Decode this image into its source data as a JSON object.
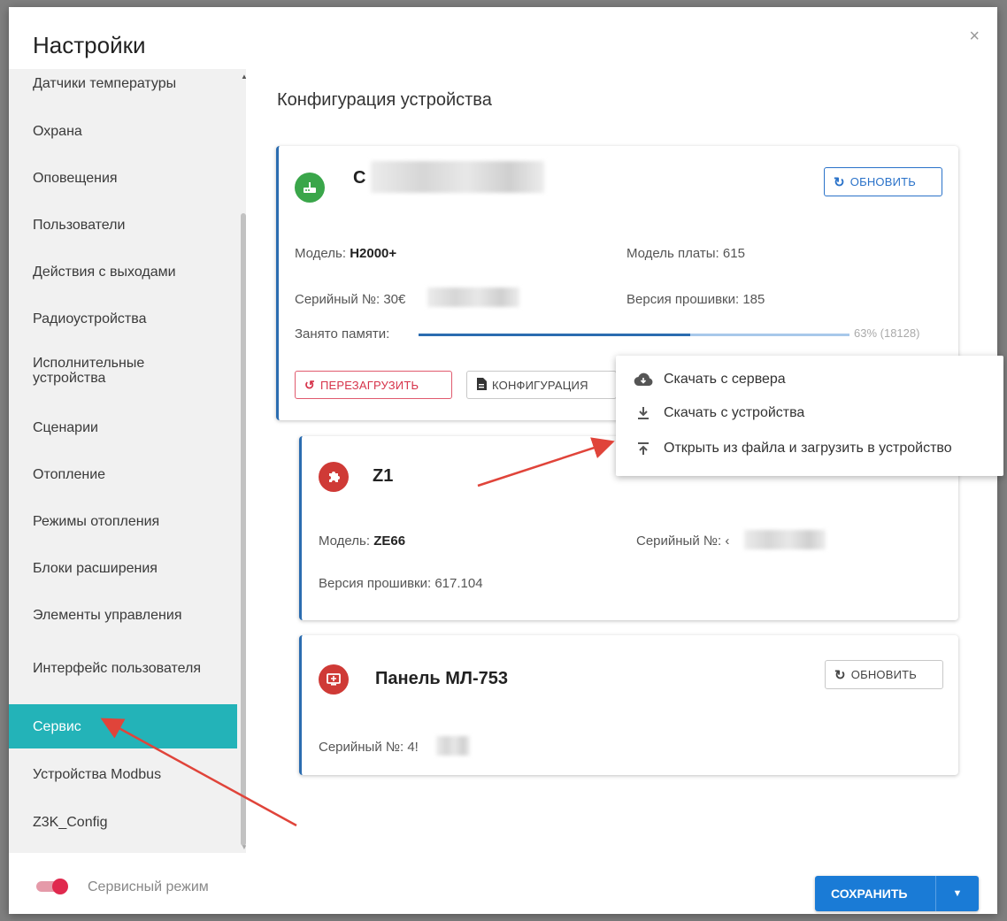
{
  "dialog": {
    "title": "Настройки",
    "close_icon": "×"
  },
  "sidebar": {
    "items": [
      {
        "label": "Датчики температуры",
        "active": false
      },
      {
        "label": "Охрана",
        "active": false
      },
      {
        "label": "Оповещения",
        "active": false
      },
      {
        "label": "Пользователи",
        "active": false
      },
      {
        "label": "Действия с выходами",
        "active": false
      },
      {
        "label": "Радиоустройства",
        "active": false
      },
      {
        "label": "Исполнительные устройства",
        "active": false
      },
      {
        "label": "Сценарии",
        "active": false
      },
      {
        "label": "Отопление",
        "active": false
      },
      {
        "label": "Режимы отопления",
        "active": false
      },
      {
        "label": "Блоки расширения",
        "active": false
      },
      {
        "label": "Элементы управления",
        "active": false
      },
      {
        "label": "Интерфейс пользователя",
        "active": false
      },
      {
        "label": "Сервис",
        "active": true
      },
      {
        "label": "Устройства Modbus",
        "active": false
      },
      {
        "label": "Z3K_Config",
        "active": false
      }
    ]
  },
  "main": {
    "section_title": "Конфигурация устройства",
    "devices": [
      {
        "name_prefix": "С",
        "icon": "router-icon",
        "icon_color": "#3aa64a",
        "refresh_label": "ОБНОВИТЬ",
        "model_label": "Модель:",
        "model_value": "H2000+",
        "board_model": "Модель платы: 615",
        "serial": "Серийный №: 30€",
        "firmware": "Версия прошивки: 185",
        "memory_label": "Занято памяти:",
        "memory_percent": 63,
        "memory_text": "63% (18128)",
        "reboot_label": "ПЕРЕЗАГРУЗИТЬ",
        "config_label": "КОНФИГУРАЦИЯ"
      },
      {
        "name": "Z1",
        "icon": "puzzle-icon",
        "icon_color": "#cf3a36",
        "model_label": "Модель:",
        "model_value": "ZE66",
        "serial": "Серийный №: ‹",
        "firmware": "Версия прошивки: 617.104"
      },
      {
        "name": "Панель МЛ-753",
        "icon": "panel-icon",
        "icon_color": "#cf3a36",
        "refresh_label": "ОБНОВИТЬ",
        "serial": "Серийный №: 4!"
      }
    ]
  },
  "menu": {
    "items": [
      {
        "label": "Скачать с сервера",
        "icon": "cloud-download-icon"
      },
      {
        "label": "Скачать с устройства",
        "icon": "download-icon"
      },
      {
        "label": "Открыть из файла и загрузить в устройство",
        "icon": "upload-icon"
      }
    ]
  },
  "footer": {
    "service_mode_label": "Сервисный режим",
    "service_mode_on": true,
    "save_label": "СОХРАНИТЬ"
  },
  "colors": {
    "accent": "#1a7bd6",
    "active_item": "#23b3b8",
    "toggle": "#e0294e",
    "arrow": "#e0443a"
  }
}
